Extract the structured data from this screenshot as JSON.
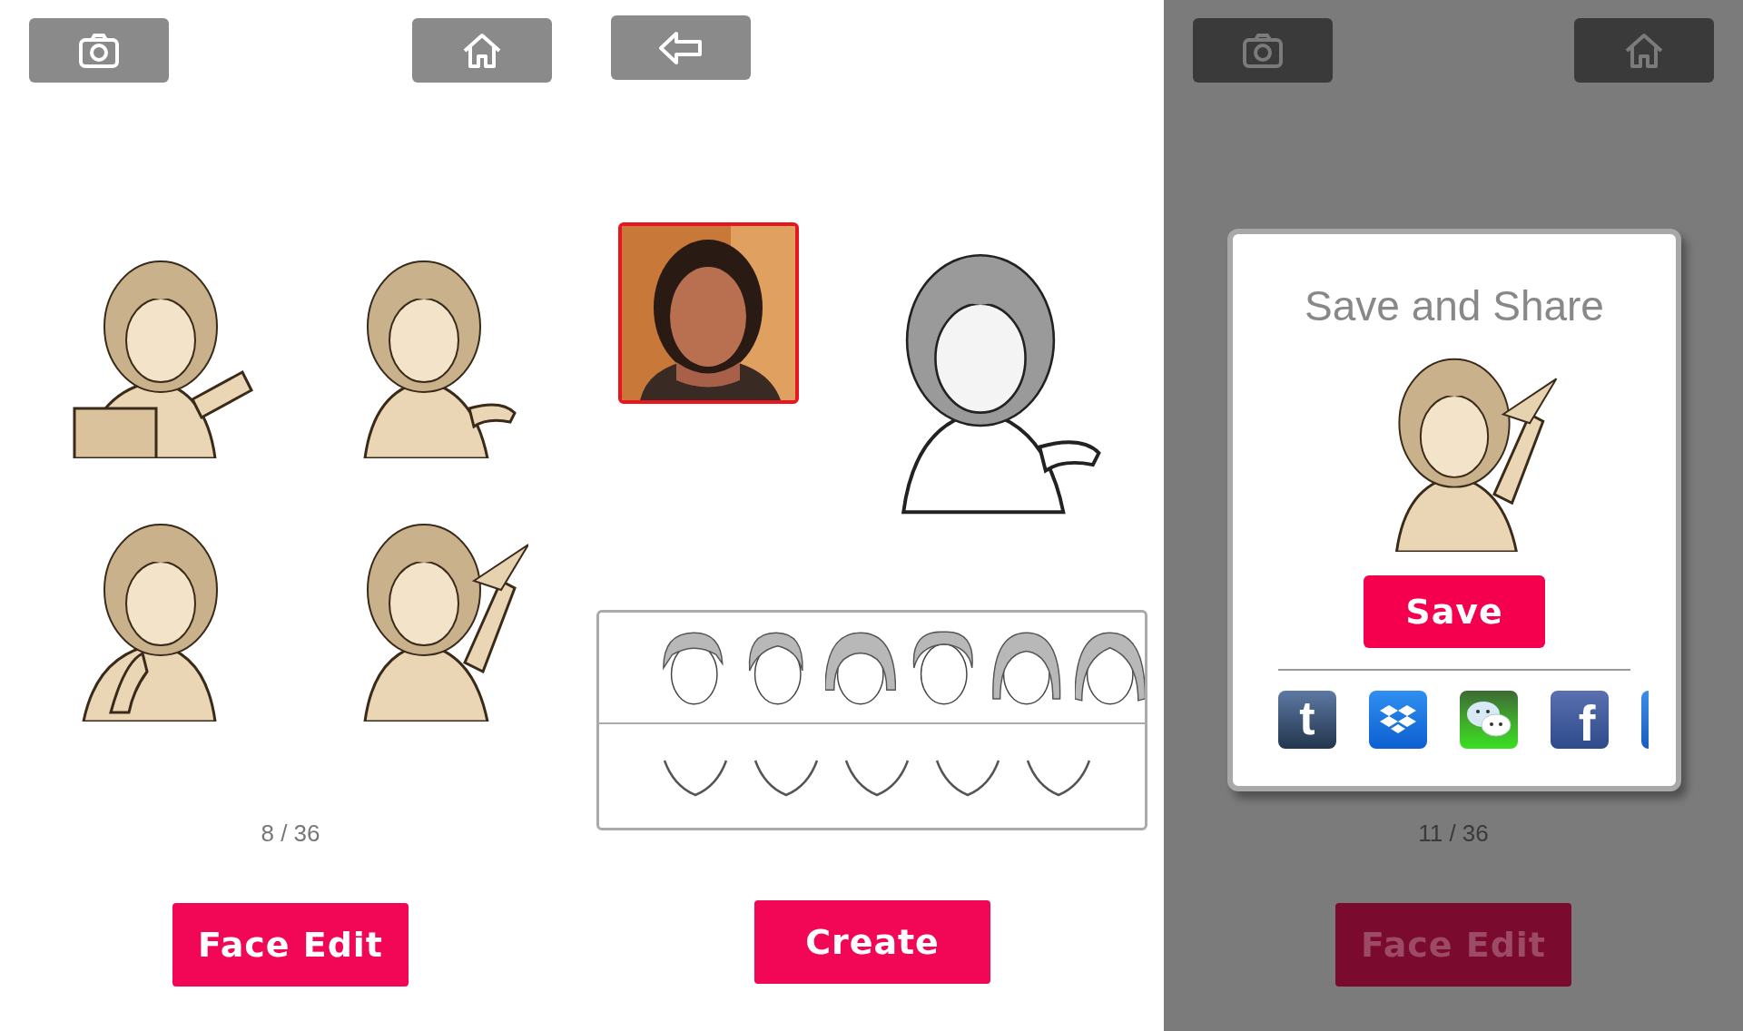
{
  "gallery_screen": {
    "toolbar": [
      {
        "kind": "camera"
      },
      {
        "kind": "home"
      }
    ],
    "page_indicator": "8 / 36",
    "button": "Face Edit"
  },
  "editor_screen": {
    "toolbar": [
      {
        "kind": "back"
      }
    ],
    "button": "Create"
  },
  "share_screen": {
    "dimmed": true,
    "toolbar": [
      {
        "kind": "camera"
      },
      {
        "kind": "home"
      }
    ],
    "dialog": {
      "title": "Save and Share",
      "save_button": "Save",
      "share_targets": [
        {
          "kind": "tumblr",
          "glyph": "t"
        },
        {
          "kind": "dropbox"
        },
        {
          "kind": "wechat"
        },
        {
          "kind": "facebook",
          "glyph": "f"
        },
        {
          "kind": "partial"
        }
      ]
    },
    "page_indicator": "11 / 36",
    "button": "Face Edit"
  }
}
